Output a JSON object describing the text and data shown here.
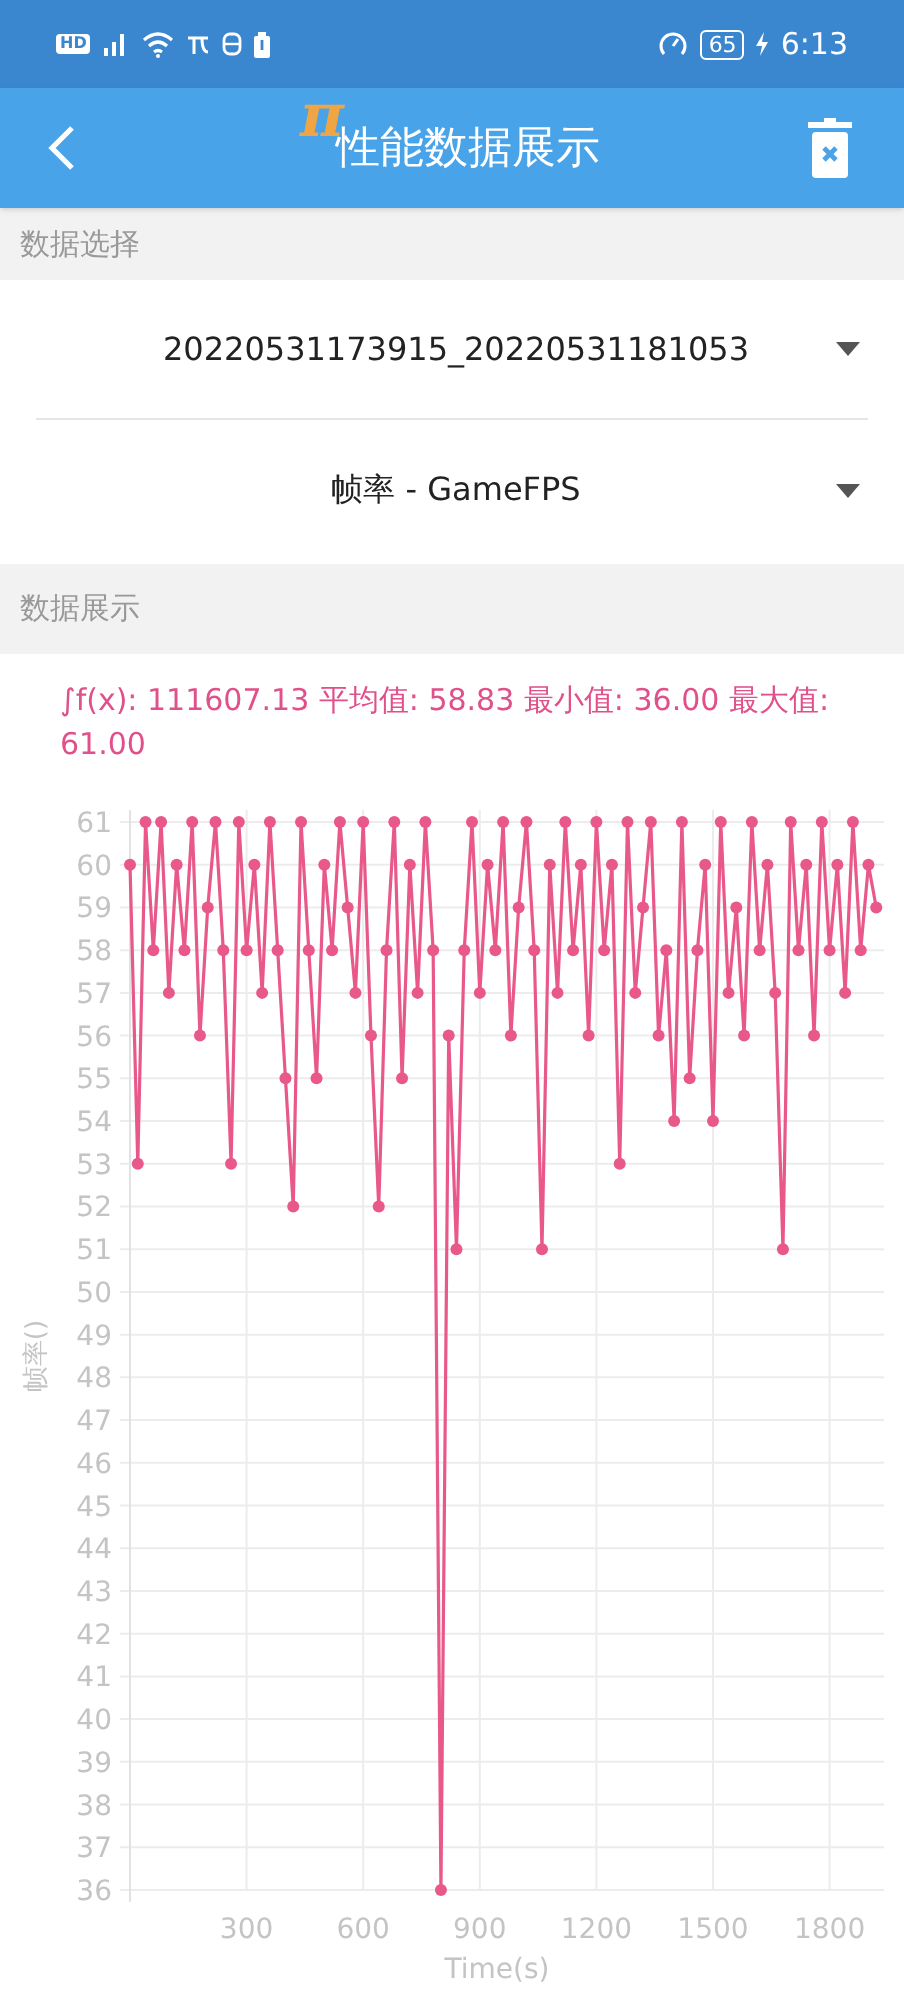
{
  "status_bar": {
    "hd_badge": "HD",
    "battery": "65",
    "time": "6:13"
  },
  "header": {
    "logo": "π",
    "title": "性能数据展示"
  },
  "sections": [
    {
      "title": "数据选择"
    },
    {
      "title": "数据展示"
    }
  ],
  "dropdowns": [
    {
      "value": "20220531173915_20220531181053"
    },
    {
      "value": "帧率 - GameFPS"
    }
  ],
  "summary": "∫f(x): 111607.13 平均值: 58.83 最小值: 36.00 最大值: 61.00",
  "chart_data": {
    "type": "line",
    "grid": true,
    "xlabel": "Time(s)",
    "ylabel": "帧率()",
    "xlim": [
      0,
      1940
    ],
    "ylim": [
      36,
      61
    ],
    "xticks": [
      300,
      600,
      900,
      1200,
      1500,
      1800
    ],
    "yticks": [
      36,
      37,
      38,
      39,
      40,
      41,
      42,
      43,
      44,
      45,
      46,
      47,
      48,
      49,
      50,
      51,
      52,
      53,
      54,
      55,
      56,
      57,
      58,
      59,
      60,
      61
    ],
    "x": [
      0,
      20,
      40,
      60,
      80,
      100,
      120,
      140,
      160,
      180,
      200,
      220,
      240,
      260,
      280,
      300,
      320,
      340,
      360,
      380,
      400,
      420,
      440,
      460,
      480,
      500,
      520,
      540,
      560,
      580,
      600,
      620,
      640,
      660,
      680,
      700,
      720,
      740,
      760,
      780,
      800,
      820,
      840,
      860,
      880,
      900,
      920,
      940,
      960,
      980,
      1000,
      1020,
      1040,
      1060,
      1080,
      1100,
      1120,
      1140,
      1160,
      1180,
      1200,
      1220,
      1240,
      1260,
      1280,
      1300,
      1320,
      1340,
      1360,
      1380,
      1400,
      1420,
      1440,
      1460,
      1480,
      1500,
      1520,
      1540,
      1560,
      1580,
      1600,
      1620,
      1640,
      1660,
      1680,
      1700,
      1720,
      1740,
      1760,
      1780,
      1800,
      1820,
      1840,
      1860,
      1880,
      1900,
      1920
    ],
    "series": [
      {
        "color": "#e8588a",
        "marker": true,
        "values": [
          60,
          53,
          61,
          58,
          61,
          57,
          60,
          58,
          61,
          56,
          59,
          61,
          58,
          53,
          61,
          58,
          60,
          57,
          61,
          58,
          55,
          52,
          61,
          58,
          55,
          60,
          58,
          61,
          59,
          57,
          61,
          56,
          52,
          58,
          61,
          55,
          60,
          57,
          61,
          58,
          36,
          56,
          51,
          58,
          61,
          57,
          60,
          58,
          61,
          56,
          59,
          61,
          58,
          51,
          60,
          57,
          61,
          58,
          60,
          56,
          61,
          58,
          60,
          53,
          61,
          57,
          59,
          61,
          56,
          58,
          54,
          61,
          55,
          58,
          60,
          54,
          61,
          57,
          59,
          56,
          61,
          58,
          60,
          57,
          51,
          61,
          58,
          60,
          56,
          61,
          58,
          60,
          57,
          61,
          58,
          60,
          59
        ]
      }
    ]
  }
}
